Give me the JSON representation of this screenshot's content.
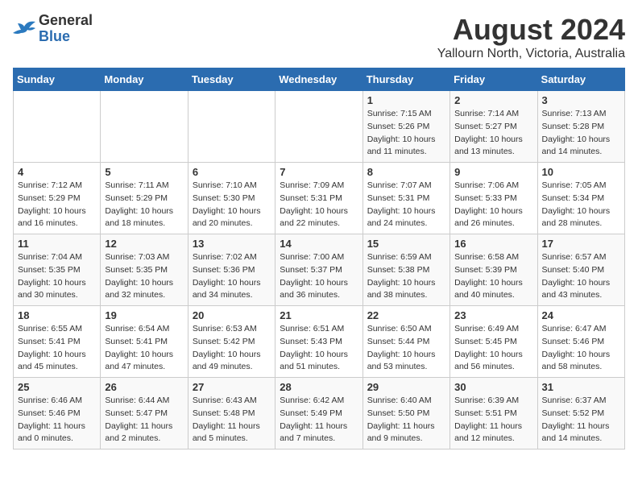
{
  "logo": {
    "general": "General",
    "blue": "Blue"
  },
  "title": "August 2024",
  "subtitle": "Yallourn North, Victoria, Australia",
  "days_of_week": [
    "Sunday",
    "Monday",
    "Tuesday",
    "Wednesday",
    "Thursday",
    "Friday",
    "Saturday"
  ],
  "weeks": [
    [
      {
        "day": "",
        "info": ""
      },
      {
        "day": "",
        "info": ""
      },
      {
        "day": "",
        "info": ""
      },
      {
        "day": "",
        "info": ""
      },
      {
        "day": "1",
        "info": "Sunrise: 7:15 AM\nSunset: 5:26 PM\nDaylight: 10 hours\nand 11 minutes."
      },
      {
        "day": "2",
        "info": "Sunrise: 7:14 AM\nSunset: 5:27 PM\nDaylight: 10 hours\nand 13 minutes."
      },
      {
        "day": "3",
        "info": "Sunrise: 7:13 AM\nSunset: 5:28 PM\nDaylight: 10 hours\nand 14 minutes."
      }
    ],
    [
      {
        "day": "4",
        "info": "Sunrise: 7:12 AM\nSunset: 5:29 PM\nDaylight: 10 hours\nand 16 minutes."
      },
      {
        "day": "5",
        "info": "Sunrise: 7:11 AM\nSunset: 5:29 PM\nDaylight: 10 hours\nand 18 minutes."
      },
      {
        "day": "6",
        "info": "Sunrise: 7:10 AM\nSunset: 5:30 PM\nDaylight: 10 hours\nand 20 minutes."
      },
      {
        "day": "7",
        "info": "Sunrise: 7:09 AM\nSunset: 5:31 PM\nDaylight: 10 hours\nand 22 minutes."
      },
      {
        "day": "8",
        "info": "Sunrise: 7:07 AM\nSunset: 5:31 PM\nDaylight: 10 hours\nand 24 minutes."
      },
      {
        "day": "9",
        "info": "Sunrise: 7:06 AM\nSunset: 5:33 PM\nDaylight: 10 hours\nand 26 minutes."
      },
      {
        "day": "10",
        "info": "Sunrise: 7:05 AM\nSunset: 5:34 PM\nDaylight: 10 hours\nand 28 minutes."
      }
    ],
    [
      {
        "day": "11",
        "info": "Sunrise: 7:04 AM\nSunset: 5:35 PM\nDaylight: 10 hours\nand 30 minutes."
      },
      {
        "day": "12",
        "info": "Sunrise: 7:03 AM\nSunset: 5:35 PM\nDaylight: 10 hours\nand 32 minutes."
      },
      {
        "day": "13",
        "info": "Sunrise: 7:02 AM\nSunset: 5:36 PM\nDaylight: 10 hours\nand 34 minutes."
      },
      {
        "day": "14",
        "info": "Sunrise: 7:00 AM\nSunset: 5:37 PM\nDaylight: 10 hours\nand 36 minutes."
      },
      {
        "day": "15",
        "info": "Sunrise: 6:59 AM\nSunset: 5:38 PM\nDaylight: 10 hours\nand 38 minutes."
      },
      {
        "day": "16",
        "info": "Sunrise: 6:58 AM\nSunset: 5:39 PM\nDaylight: 10 hours\nand 40 minutes."
      },
      {
        "day": "17",
        "info": "Sunrise: 6:57 AM\nSunset: 5:40 PM\nDaylight: 10 hours\nand 43 minutes."
      }
    ],
    [
      {
        "day": "18",
        "info": "Sunrise: 6:55 AM\nSunset: 5:41 PM\nDaylight: 10 hours\nand 45 minutes."
      },
      {
        "day": "19",
        "info": "Sunrise: 6:54 AM\nSunset: 5:41 PM\nDaylight: 10 hours\nand 47 minutes."
      },
      {
        "day": "20",
        "info": "Sunrise: 6:53 AM\nSunset: 5:42 PM\nDaylight: 10 hours\nand 49 minutes."
      },
      {
        "day": "21",
        "info": "Sunrise: 6:51 AM\nSunset: 5:43 PM\nDaylight: 10 hours\nand 51 minutes."
      },
      {
        "day": "22",
        "info": "Sunrise: 6:50 AM\nSunset: 5:44 PM\nDaylight: 10 hours\nand 53 minutes."
      },
      {
        "day": "23",
        "info": "Sunrise: 6:49 AM\nSunset: 5:45 PM\nDaylight: 10 hours\nand 56 minutes."
      },
      {
        "day": "24",
        "info": "Sunrise: 6:47 AM\nSunset: 5:46 PM\nDaylight: 10 hours\nand 58 minutes."
      }
    ],
    [
      {
        "day": "25",
        "info": "Sunrise: 6:46 AM\nSunset: 5:46 PM\nDaylight: 11 hours\nand 0 minutes."
      },
      {
        "day": "26",
        "info": "Sunrise: 6:44 AM\nSunset: 5:47 PM\nDaylight: 11 hours\nand 2 minutes."
      },
      {
        "day": "27",
        "info": "Sunrise: 6:43 AM\nSunset: 5:48 PM\nDaylight: 11 hours\nand 5 minutes."
      },
      {
        "day": "28",
        "info": "Sunrise: 6:42 AM\nSunset: 5:49 PM\nDaylight: 11 hours\nand 7 minutes."
      },
      {
        "day": "29",
        "info": "Sunrise: 6:40 AM\nSunset: 5:50 PM\nDaylight: 11 hours\nand 9 minutes."
      },
      {
        "day": "30",
        "info": "Sunrise: 6:39 AM\nSunset: 5:51 PM\nDaylight: 11 hours\nand 12 minutes."
      },
      {
        "day": "31",
        "info": "Sunrise: 6:37 AM\nSunset: 5:52 PM\nDaylight: 11 hours\nand 14 minutes."
      }
    ]
  ]
}
